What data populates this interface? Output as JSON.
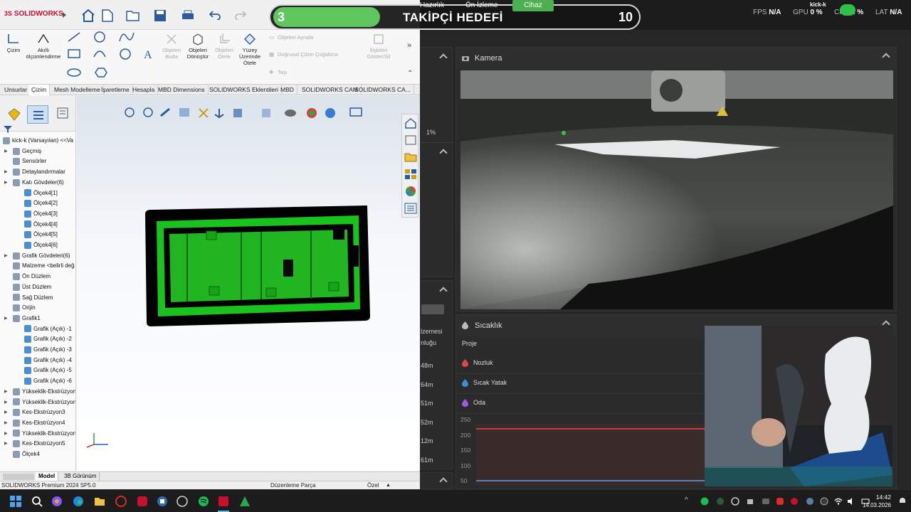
{
  "hud": {
    "left_number": "3",
    "title": "TAKİPÇİ HEDEFİ",
    "right_number": "10",
    "tabs": [
      "Hazırlık",
      "Ön İzleme",
      "Cihaz"
    ]
  },
  "dashboard": {
    "metrics": {
      "fps_label": "FPS",
      "fps_value": "N/A",
      "gpu_label": "GPU",
      "gpu_value": "0 %",
      "cpu_label": "CPU",
      "cpu_value": "2 %",
      "lat_label": "LAT",
      "lat_value": "N/A",
      "user": "kick-k"
    },
    "camera_title": "Kamera",
    "temp_title": "Sıcaklık",
    "temp_header": "Proje",
    "temp_rows": [
      "Nozluk",
      "Sıcak Yatak",
      "Oda"
    ],
    "temp_colors": [
      "#e04848",
      "#3a8fd8",
      "#9b5de5"
    ],
    "y_ticks": [
      "250",
      "200",
      "150",
      "100",
      "50"
    ],
    "left_fragments": {
      "percent": "1%",
      "label1": "lzemesi",
      "label2": "nluğu",
      "times": [
        "48m",
        "64m",
        "51m",
        "52m",
        "12m",
        "61m"
      ]
    }
  },
  "solidworks": {
    "app_name": "SOLIDWORKS",
    "ribbon": {
      "cizim": "Çizim",
      "akilli": "Akıllı ölçümlendirme",
      "objeleri_buda": "Objeleri Buda",
      "objeleri_donustur": "Objeleri Dönüştür",
      "objeleri_otele": "Objeleri Ötele",
      "yuzey_otele": "Yüzey Üzerinde Ötele",
      "objeleri_aynala": "Objeleri Aynala",
      "dogrusal": "Doğrusal Çizim Çoğaltma",
      "tasi": "Taşı",
      "iliskileri": "İlişkileri Göster/Sil"
    },
    "tabs": [
      "Unsurlar",
      "Çizim",
      "Mesh Modelleme",
      "İşaretleme",
      "Hesapla",
      "MBD Dimensions",
      "SOLIDWORKS Eklentileri",
      "MBD",
      "SOLIDWORKS CAM",
      "SOLIDWORKS CA..."
    ],
    "tree": [
      {
        "label": "kick-k (Varsayılan) <<Va",
        "level": 0,
        "arrow": false
      },
      {
        "label": "Geçmiş",
        "level": 1,
        "arrow": true
      },
      {
        "label": "Sensörler",
        "level": 1,
        "arrow": false
      },
      {
        "label": "Detaylandırmalar",
        "level": 1,
        "arrow": true
      },
      {
        "label": "Katı Gövdeler(6)",
        "level": 1,
        "arrow": true
      },
      {
        "label": "Ölçek4[1]",
        "level": 2,
        "arrow": false
      },
      {
        "label": "Ölçek4[2]",
        "level": 2,
        "arrow": false
      },
      {
        "label": "Ölçek4[3]",
        "level": 2,
        "arrow": false
      },
      {
        "label": "Ölçek4[4]",
        "level": 2,
        "arrow": false
      },
      {
        "label": "Ölçek4[5]",
        "level": 2,
        "arrow": false
      },
      {
        "label": "Ölçek4[6]",
        "level": 2,
        "arrow": false
      },
      {
        "label": "Grafik Gövdeleri(6)",
        "level": 1,
        "arrow": true
      },
      {
        "label": "Malzeme <belirli değ",
        "level": 1,
        "arrow": false
      },
      {
        "label": "Ön Düzlem",
        "level": 1,
        "arrow": false
      },
      {
        "label": "Üst Düzlem",
        "level": 1,
        "arrow": false
      },
      {
        "label": "Sağ Düzlem",
        "level": 1,
        "arrow": false
      },
      {
        "label": "Orijin",
        "level": 1,
        "arrow": false
      },
      {
        "label": "Grafik1",
        "level": 1,
        "arrow": true
      },
      {
        "label": "Grafik (Açık) -1",
        "level": 2,
        "arrow": false
      },
      {
        "label": "Grafik (Açık) -2",
        "level": 2,
        "arrow": false
      },
      {
        "label": "Grafik (Açık) -3",
        "level": 2,
        "arrow": false
      },
      {
        "label": "Grafik (Açık) -4",
        "level": 2,
        "arrow": false
      },
      {
        "label": "Grafik (Açık) -5",
        "level": 2,
        "arrow": false
      },
      {
        "label": "Grafik (Açık) -6",
        "level": 2,
        "arrow": false
      },
      {
        "label": "Yükseklik-Ekstrüzyon",
        "level": 1,
        "arrow": true
      },
      {
        "label": "Yükseklik-Ekstrüzyon",
        "level": 1,
        "arrow": true
      },
      {
        "label": "Kes-Ekstrüzyon3",
        "level": 1,
        "arrow": true
      },
      {
        "label": "Kes-Ekstrüzyon4",
        "level": 1,
        "arrow": true
      },
      {
        "label": "Yükseklik-Ekstrüzyon",
        "level": 1,
        "arrow": true
      },
      {
        "label": "Kes-Ekstrüzyon5",
        "level": 1,
        "arrow": true
      },
      {
        "label": "Ölçek4",
        "level": 1,
        "arrow": false
      }
    ],
    "bottom_tabs": [
      "Model",
      "3B Görünüm"
    ],
    "status": {
      "product": "SOLIDWORKS Premium 2024 SP5.0",
      "mode": "Düzenleme Parça",
      "custom": "Özel"
    }
  },
  "taskbar": {
    "time": "14:42",
    "date": "14.03.2026"
  }
}
